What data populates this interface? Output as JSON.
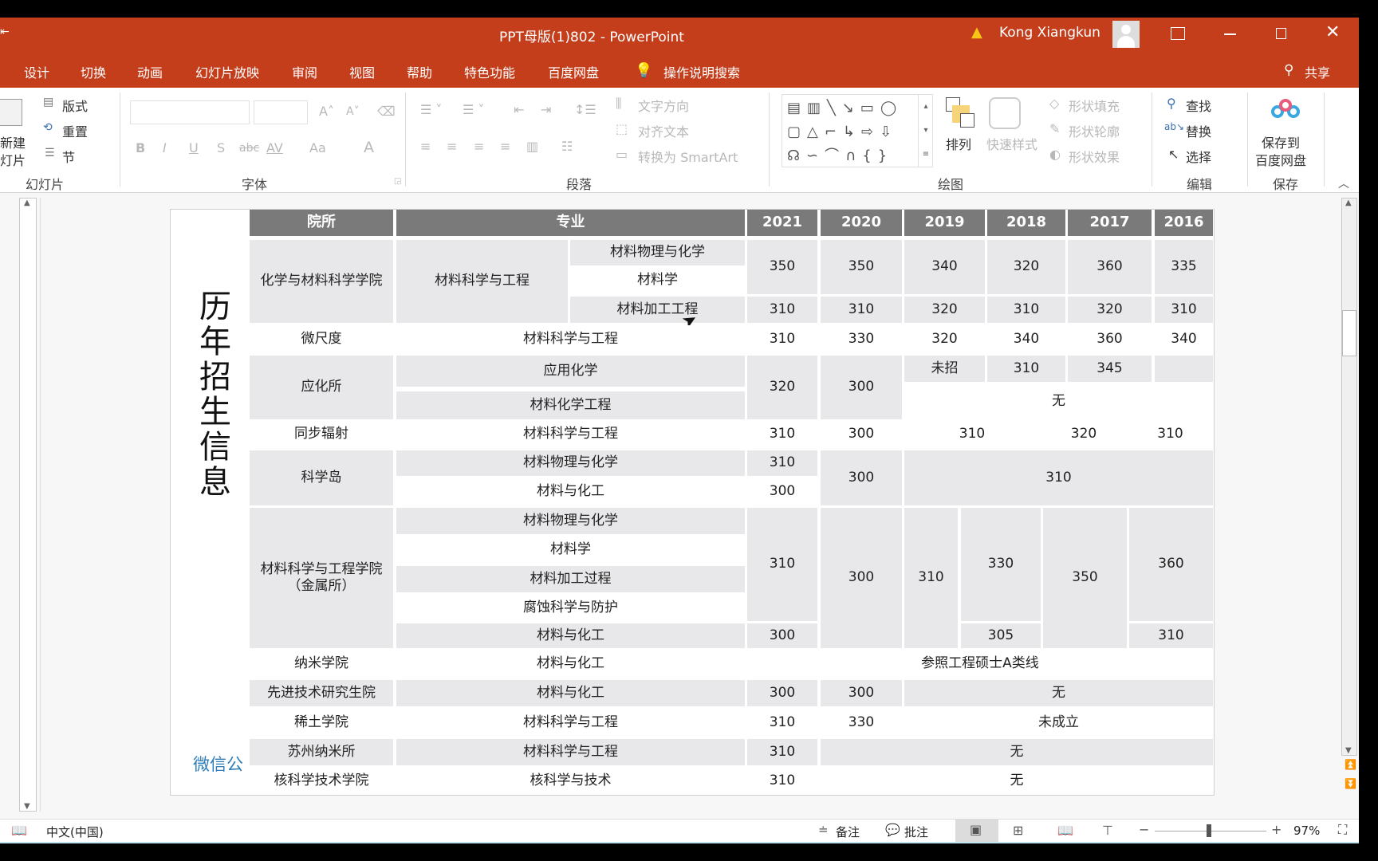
{
  "window": {
    "title": "PPT母版(1)802  -  PowerPoint",
    "user": "Kong Xiangkun",
    "warning_icon": "warning-icon",
    "controls": [
      "ribbon-display-icon",
      "minimize-icon",
      "restore-icon",
      "close-icon"
    ]
  },
  "tabs": [
    "设计",
    "切换",
    "动画",
    "幻灯片放映",
    "审阅",
    "视图",
    "帮助",
    "特色功能",
    "百度网盘"
  ],
  "tell_me": "操作说明搜索",
  "share": "共享",
  "ribbon": {
    "slides_group": {
      "new_slide": "新建\n幻灯片",
      "new_slide_line1": "新建",
      "new_slide_line2": "灯片",
      "layout": "版式",
      "reset": "重置",
      "section": "节",
      "label": "幻灯片"
    },
    "font_group": {
      "font_name": "",
      "font_size": "",
      "label": "字体",
      "bold": "B",
      "italic": "I",
      "underline": "U",
      "shadow": "S",
      "strike": "abc",
      "spacing": "AV",
      "case": "Aa",
      "color": "A",
      "grow": "A",
      "shrink": "A"
    },
    "paragraph_group": {
      "text_direction": "文字方向",
      "align_text": "对齐文本",
      "smartart": "转换为 SmartArt",
      "label": "段落"
    },
    "drawing_group": {
      "arrange": "排列",
      "quick_styles": "快速样式",
      "shape_fill": "形状填充",
      "shape_outline": "形状轮廓",
      "shape_effects": "形状效果",
      "label": "绘图"
    },
    "editing_group": {
      "find": "查找",
      "replace": "替换",
      "select": "选择",
      "label": "编辑"
    },
    "save_group": {
      "save_to_baidu_line1": "保存到",
      "save_to_baidu_line2": "百度网盘",
      "label": "保存"
    }
  },
  "slide": {
    "vertical_title": "历年招生信息",
    "watermark": "微信公",
    "table": {
      "headers": {
        "institute": "院所",
        "major": "专业",
        "years": [
          "2021",
          "2020",
          "2019",
          "2018",
          "2017",
          "2016"
        ]
      },
      "rows": {
        "r1": {
          "institute": "化学与材料科学学院",
          "major": "材料科学与工程",
          "subs": [
            "材料物理与化学",
            "材料学",
            "材料加工工程"
          ],
          "scores_a": [
            "350",
            "350",
            "340",
            "320",
            "360",
            "335"
          ],
          "scores_b": [
            "310",
            "310",
            "320",
            "310",
            "320",
            "310"
          ]
        },
        "r2": {
          "institute": "微尺度",
          "major": "材料科学与工程",
          "scores": [
            "310",
            "330",
            "320",
            "340",
            "360",
            "340"
          ]
        },
        "r3": {
          "institute": "应化所",
          "majors": [
            "应用化学",
            "材料化学工程"
          ],
          "y2021": "320",
          "y2020": "300",
          "y2019": "未招",
          "y2018": "310",
          "y2017": "345",
          "y2016": "",
          "none": "无"
        },
        "r4": {
          "institute": "同步辐射",
          "major": "材料科学与工程",
          "y2021": "310",
          "y2020": "300",
          "y2019_2018": "310",
          "y2017": "320",
          "y2016": "310"
        },
        "r5": {
          "institute": "科学岛",
          "majors": [
            "材料物理与化学",
            "材料与化工"
          ],
          "y2021": [
            "310",
            "300"
          ],
          "y2020": "300",
          "rest": "310"
        },
        "r6": {
          "institute": "材料科学与工程学院（金属所）",
          "majors": [
            "材料物理与化学",
            "材料学",
            "材料加工过程",
            "腐蚀科学与防护",
            "材料与化工"
          ],
          "y2021": [
            "310",
            "300"
          ],
          "y2020": "300",
          "y2019": "310",
          "y2018": [
            "330",
            "305"
          ],
          "y2017": "350",
          "y2016": [
            "360",
            "310"
          ]
        },
        "r7": {
          "institute": "纳米学院",
          "major": "材料与化工",
          "note": "参照工程硕士A类线"
        },
        "r8": {
          "institute": "先进技术研究生院",
          "major": "材料与化工",
          "y2021": "300",
          "y2020": "300",
          "rest": "无"
        },
        "r9": {
          "institute": "稀土学院",
          "major": "材料科学与工程",
          "y2021": "310",
          "y2020": "330",
          "rest": "未成立"
        },
        "r10": {
          "institute": "苏州纳米所",
          "major": "材料科学与工程",
          "y2021": "310",
          "rest": "无"
        },
        "r11": {
          "institute": "核科学技术学院",
          "major": "核科学与技术",
          "y2021": "310",
          "rest": "无"
        }
      }
    }
  },
  "status": {
    "language": "中文(中国)",
    "notes": "备注",
    "comments": "批注",
    "zoom": "97%",
    "zoom_level_percent": 97
  },
  "colors": {
    "brand": "#c43e1c",
    "header": "#7a7a7a",
    "cell_gray": "#e8e8ea",
    "watermark": "#2e7cb8"
  }
}
